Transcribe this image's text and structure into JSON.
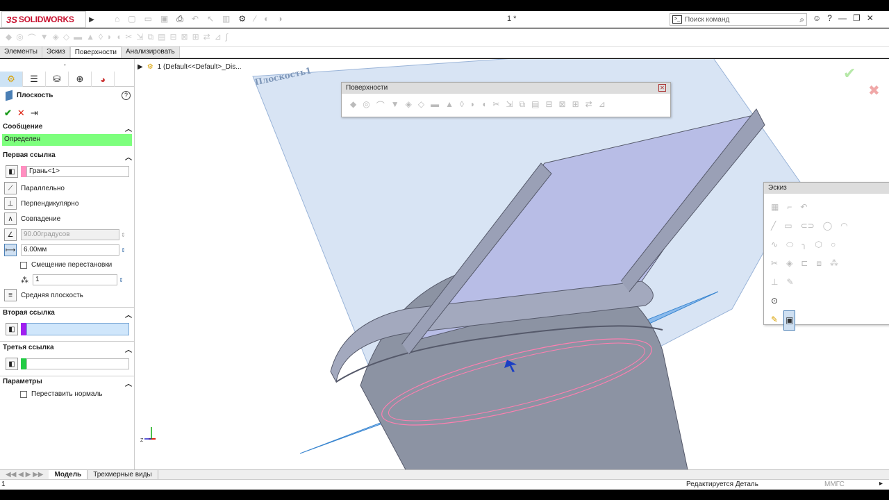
{
  "app": {
    "logo_ds": "3S",
    "logo_name": "SOLIDWORKS",
    "doc_title": "1 *",
    "search_placeholder": "Поиск команд",
    "help_label": "?"
  },
  "tabs": [
    "Элементы",
    "Эскиз",
    "Поверхности",
    "Анализировать"
  ],
  "tree_path": "1  (Default<<Default>_Dis...",
  "property_manager": {
    "title": "Плоскость",
    "help": "?",
    "message_header": "Сообщение",
    "message_text": "Определен",
    "message_color": "#7dff7d",
    "first_ref_header": "Первая ссылка",
    "first_ref_value": "Грань<1>",
    "first_ref_color": "#ff8fc0",
    "options": {
      "parallel": "Параллельно",
      "perpendicular": "Перпендикулярно",
      "coincident": "Совпадение",
      "angle_value": "90.00градусов",
      "offset_value": "6.00мм",
      "flip_offset": "Смещение перестановки",
      "count_value": "1",
      "mid_plane": "Средняя плоскость"
    },
    "second_ref_header": "Вторая ссылка",
    "second_ref_color": "#a020f0",
    "third_ref_header": "Третья ссылка",
    "third_ref_color": "#22cc44",
    "params_header": "Параметры",
    "flip_normal": "Переставить нормаль"
  },
  "viewport": {
    "plane_label": "Плоскость1",
    "surfaces_toolbar_title": "Поверхности",
    "sketch_toolbar_title": "Эскиз"
  },
  "bottom_tabs": [
    "Модель",
    "Трехмерные виды"
  ],
  "status": {
    "left": "1",
    "editing": "Редактируется Деталь",
    "units": "ММГС"
  }
}
